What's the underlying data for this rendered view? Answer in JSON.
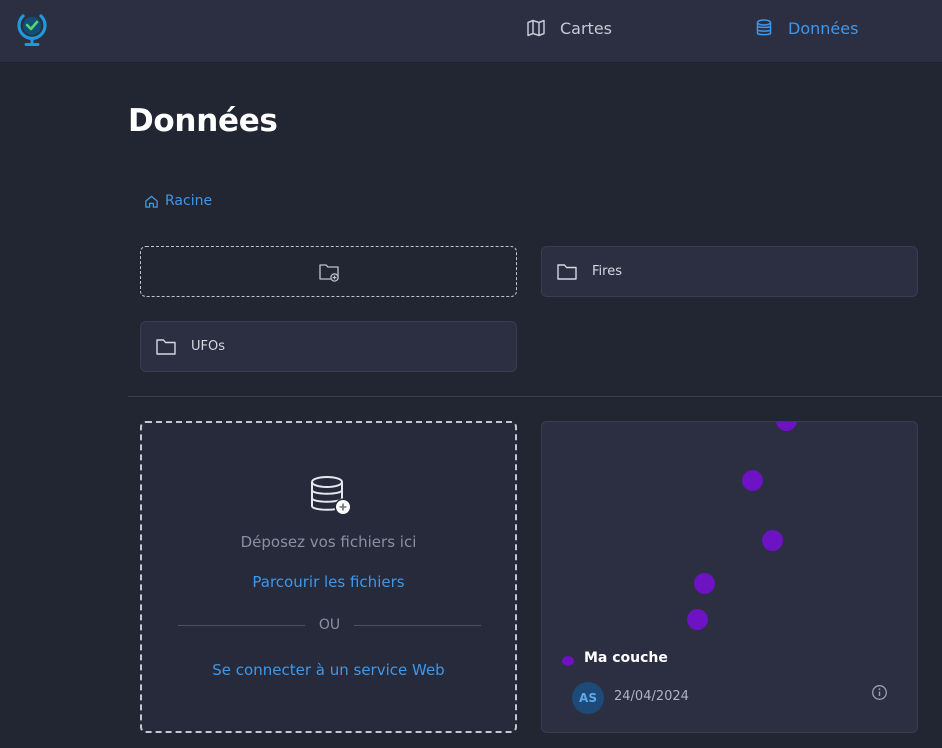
{
  "header": {
    "logo": "globe-check-logo",
    "nav": [
      {
        "label": "Cartes",
        "icon": "map-icon"
      },
      {
        "label": "Données",
        "icon": "database-icon",
        "active": true
      }
    ]
  },
  "page": {
    "title": "Données",
    "breadcrumb": {
      "label": "Racine",
      "icon": "home-icon"
    }
  },
  "folders": {
    "new_folder_icon": "folder-plus-icon",
    "items": [
      {
        "label": "Fires",
        "icon": "folder-icon"
      },
      {
        "label": "UFOs",
        "icon": "folder-icon"
      }
    ]
  },
  "dropzone": {
    "icon": "database-plus-icon",
    "text": "Déposez vos fichiers ici",
    "browse_label": "Parcourir les fichiers",
    "or_label": "OU",
    "connect_label": "Se connecter à un service Web"
  },
  "layer_card": {
    "name": "Ma couche",
    "owner_initials": "AS",
    "date": "24/04/2024",
    "info_icon": "info-icon",
    "point_color": "#6d13c4"
  },
  "colors": {
    "accent": "#3f97ea",
    "background": "#222633",
    "surface": "#2b2f41"
  }
}
